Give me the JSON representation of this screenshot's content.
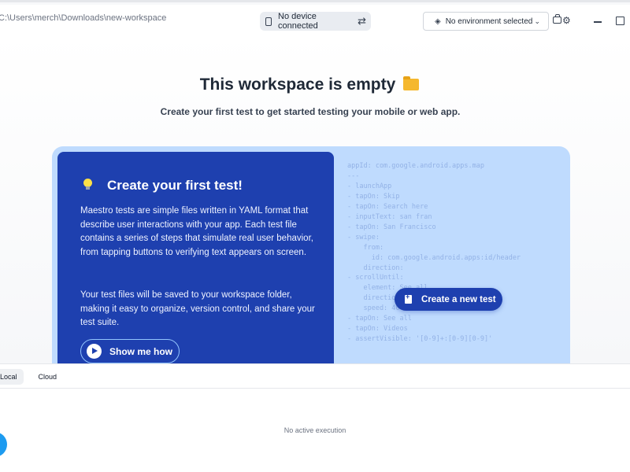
{
  "titlebar": {
    "path": "C:\\Users\\merch\\Downloads\\new-workspace",
    "device_status": "No device connected",
    "environment": "No environment selected",
    "icons": [
      "phone-icon",
      "swap-icon",
      "layers-icon",
      "chevron-down-icon",
      "bag-icon",
      "gear-icon",
      "minimize-icon",
      "maximize-icon"
    ]
  },
  "main": {
    "heading": "This workspace is empty",
    "subheading": "Create your first test to get started testing your mobile or web app.",
    "card": {
      "title": "Create your first test!",
      "paragraph1": "Maestro tests are simple files written in YAML format that describe user interactions with your app. Each test file contains a series of steps that simulate real user behavior, from tapping buttons to verifying text appears on screen.",
      "paragraph2": "Your test files will be saved to your workspace folder, making it easy to organize, version control, and share your test suite.",
      "show_button": "Show me how"
    },
    "code_lines": [
      "appId: com.google.android.apps.map",
      "---",
      "- launchApp",
      "- tapOn: Skip",
      "- tapOn: Search here",
      "- inputText: san fran",
      "- tapOn: San Francisco",
      "- swipe:",
      "    from:",
      "      id: com.google.android.apps:id/header",
      "    direction:",
      "- scrollUntil:",
      "    element: See all",
      "    direction: RIGHT",
      "    speed: 40",
      "- tapOn: See all",
      "- tapOn: Videos",
      "- assertVisible: '[0-9]+:[0-9][0-9]'"
    ],
    "create_button": "Create a new test"
  },
  "bottom": {
    "tabs": [
      "Local",
      "Cloud"
    ],
    "active_tab": "Local",
    "empty_message": "No active execution"
  },
  "colors": {
    "accent": "#1e40af",
    "card_bg": "#bfdbfe",
    "fab": "#1d9bf0"
  }
}
